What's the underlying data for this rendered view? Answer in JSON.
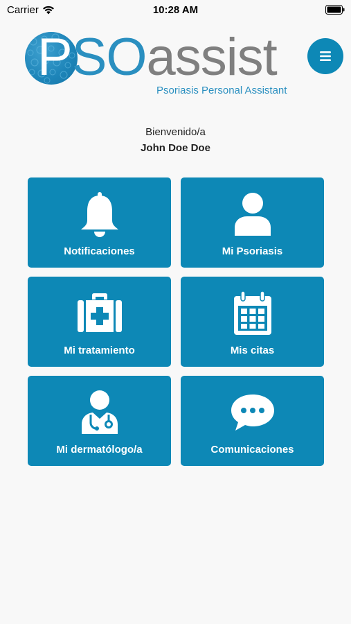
{
  "status_bar": {
    "carrier": "Carrier",
    "time": "10:28 AM"
  },
  "header": {
    "logo_p": "P",
    "logo_so": "SO",
    "logo_assist": "assist",
    "tagline": "Psoriasis Personal Assistant",
    "menu_icon": "hamburger-icon"
  },
  "welcome": {
    "label": "Bienvenido/a",
    "name": "John Doe Doe"
  },
  "tiles": [
    {
      "label": "Notificaciones",
      "icon": "bell-icon"
    },
    {
      "label": "Mi Psoriasis",
      "icon": "user-icon"
    },
    {
      "label": "Mi tratamiento",
      "icon": "medical-kit-icon"
    },
    {
      "label": "Mis citas",
      "icon": "calendar-icon"
    },
    {
      "label": "Mi dermatólogo/a",
      "icon": "doctor-icon"
    },
    {
      "label": "Comunicaciones",
      "icon": "chat-bubble-icon"
    }
  ],
  "colors": {
    "primary": "#0d88b6",
    "logo_blue": "#2a8fc0",
    "logo_gray": "#7f7f7f",
    "background": "#f8f8f8"
  }
}
